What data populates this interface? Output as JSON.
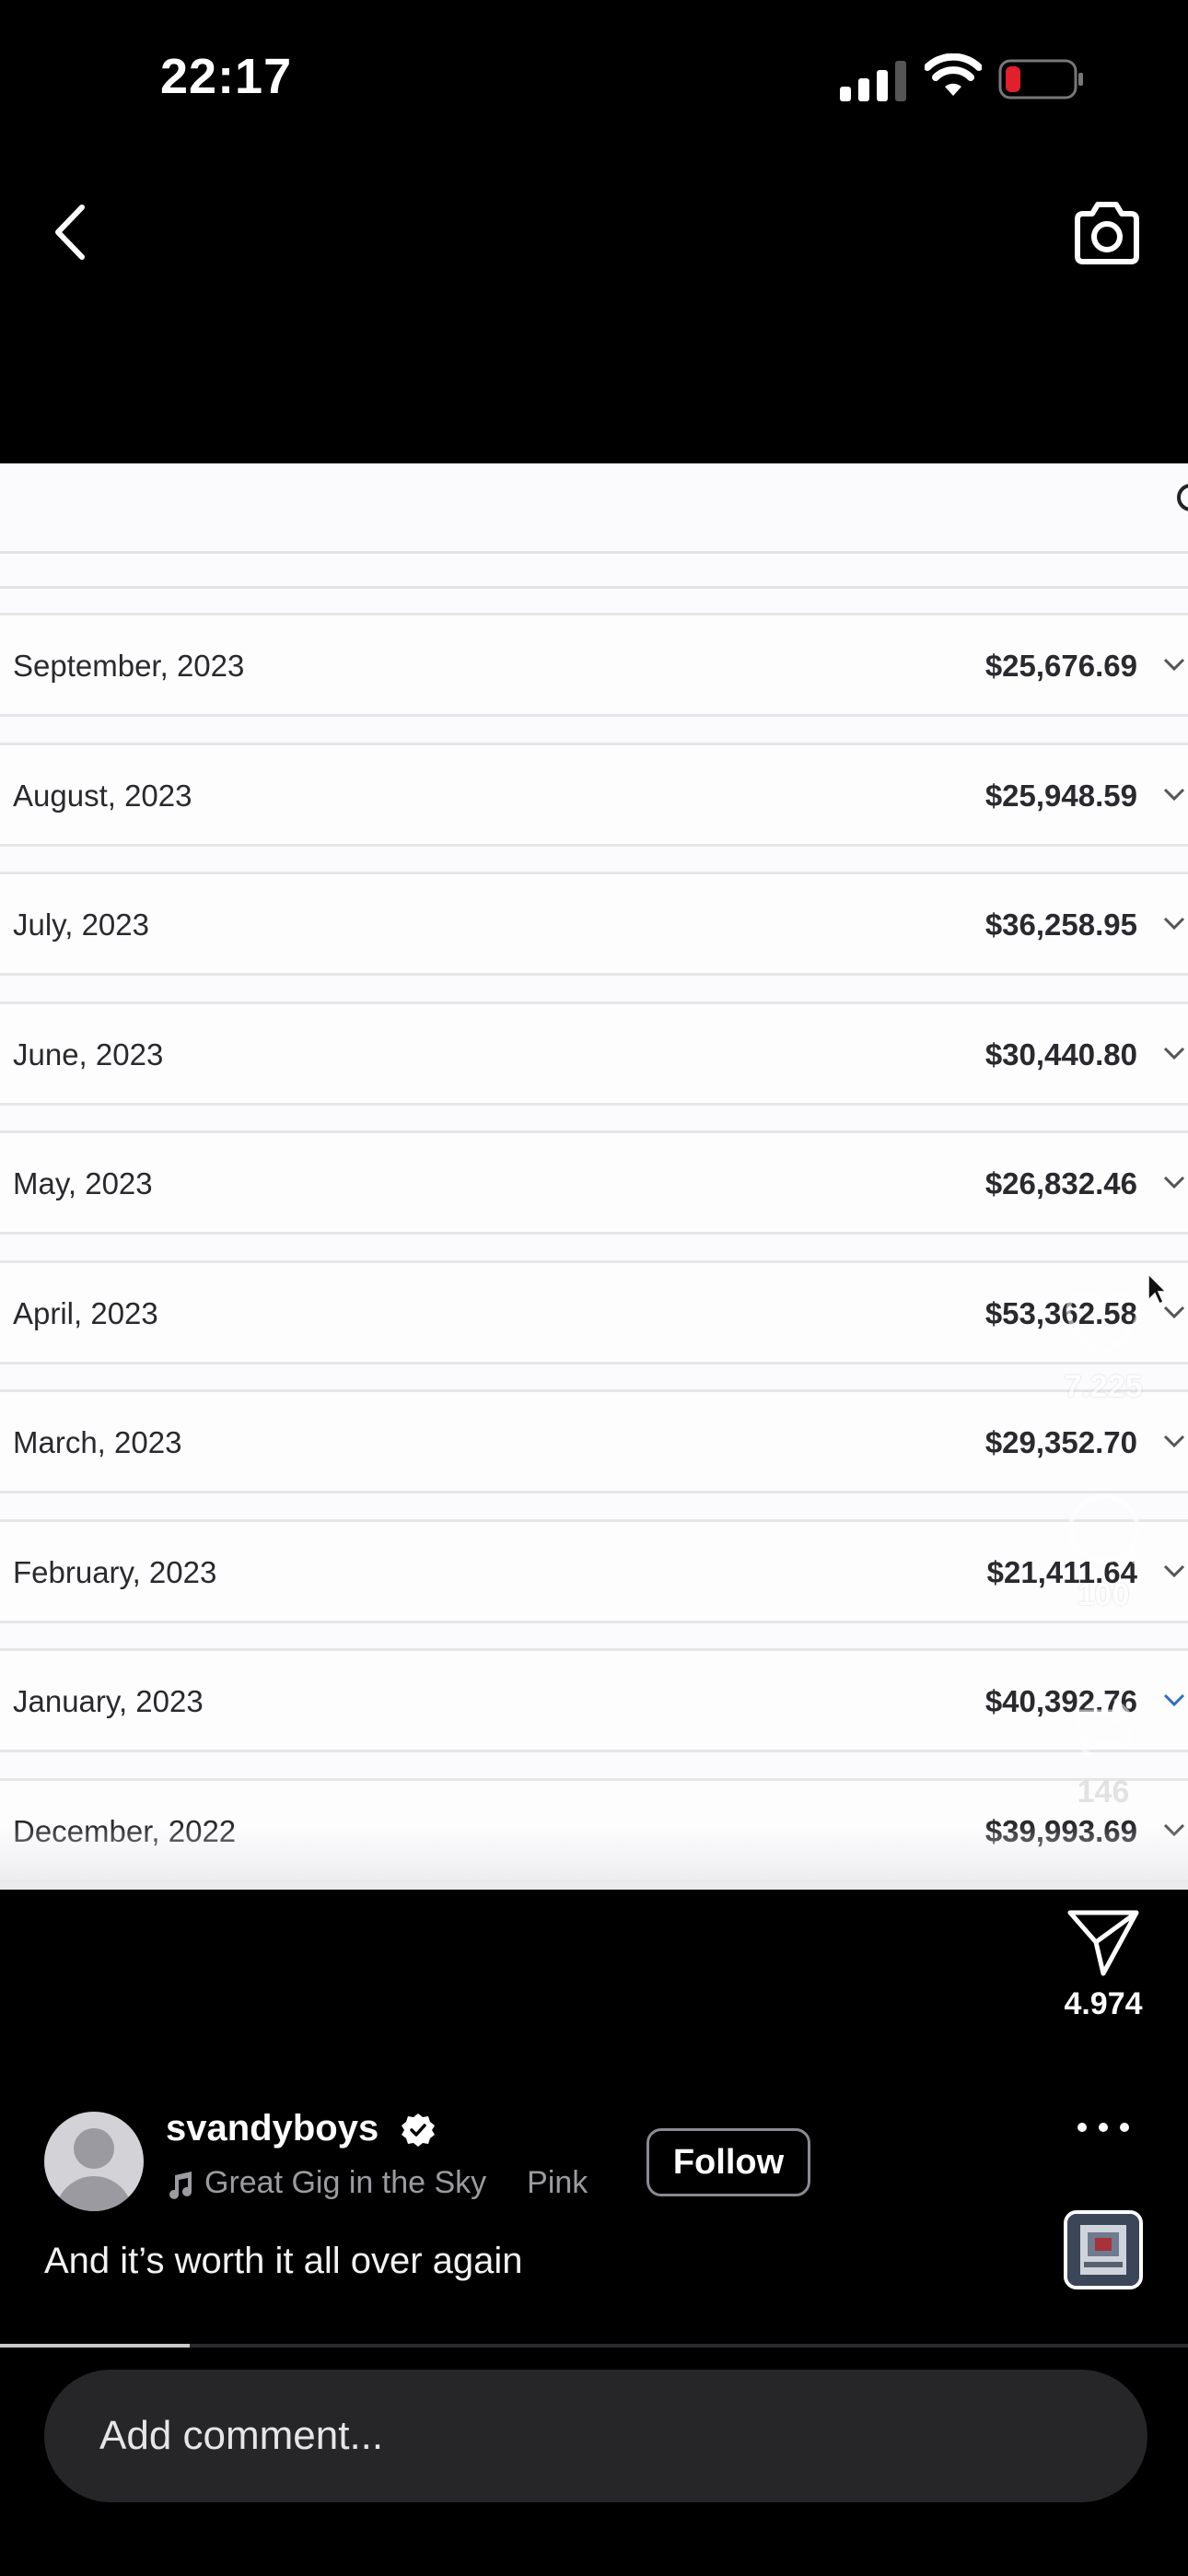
{
  "status_bar": {
    "time": "22:17",
    "battery_color": "#e0202a",
    "signal_bars": 3
  },
  "nav": {
    "back_icon": "chevron-left-icon",
    "camera_icon": "camera-icon"
  },
  "table": {
    "rows": [
      {
        "month": "September, 2023",
        "amount": "$25,676.69"
      },
      {
        "month": "August, 2023",
        "amount": "$25,948.59"
      },
      {
        "month": "July, 2023",
        "amount": "$36,258.95"
      },
      {
        "month": "June, 2023",
        "amount": "$30,440.80"
      },
      {
        "month": "May, 2023",
        "amount": "$26,832.46"
      },
      {
        "month": "April, 2023",
        "amount": "$53,362.58"
      },
      {
        "month": "March, 2023",
        "amount": "$29,352.70"
      },
      {
        "month": "February, 2023",
        "amount": "$21,411.64"
      },
      {
        "month": "January, 2023",
        "amount": "$40,392.76"
      },
      {
        "month": "December, 2022",
        "amount": "$39,993.69"
      }
    ]
  },
  "actions": {
    "like_count": "7.225",
    "comment_count": "100",
    "repost_count": "146",
    "share_count": "4.974"
  },
  "post": {
    "username": "svandyboys",
    "song": "Great Gig in the Sky",
    "artist": "Pink",
    "follow_label": "Follow",
    "caption": "And it’s worth it all over again",
    "progress": 0.16
  },
  "comment": {
    "placeholder": "Add comment..."
  }
}
